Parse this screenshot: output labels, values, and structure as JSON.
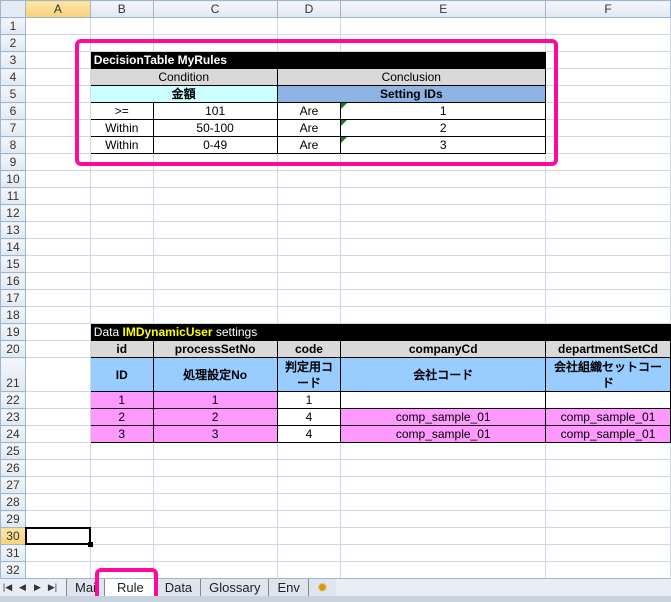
{
  "columns": [
    "A",
    "B",
    "C",
    "D",
    "E",
    "F"
  ],
  "selected_cell": {
    "column": "A",
    "row": "30"
  },
  "decision_table": {
    "title": "DecisionTable MyRules",
    "condition": "Condition",
    "conclusion": "Conclusion",
    "condition_field": "金額",
    "conclusion_field": "Setting IDs",
    "rows": [
      {
        "op": ">=",
        "value": "101",
        "cop": "Are",
        "result": "1"
      },
      {
        "op": "Within",
        "value": "50-100",
        "cop": "Are",
        "result": "2"
      },
      {
        "op": "Within",
        "value": "0-49",
        "cop": "Are",
        "result": "3"
      }
    ]
  },
  "data_table": {
    "title_prefix": "Data",
    "title_name": "IMDynamicUser",
    "title_suffix": "settings",
    "headers": [
      "id",
      "processSetNo",
      "code",
      "companyCd",
      "departmentSetCd"
    ],
    "labels": [
      "ID",
      "処理設定No",
      "判定用コード",
      "会社コード",
      "会社組織セットコード"
    ],
    "rows": [
      [
        "1",
        "1",
        "1",
        "",
        ""
      ],
      [
        "2",
        "2",
        "4",
        "comp_sample_01",
        "comp_sample_01"
      ],
      [
        "3",
        "3",
        "4",
        "comp_sample_01",
        "comp_sample_01"
      ]
    ]
  },
  "sheet_tabs": [
    "Mai",
    "Rule",
    "Data",
    "Glossary",
    "Env"
  ],
  "active_tab": "Rule",
  "colors": {
    "highlight": "#ff0a9c",
    "pink": "#ff99ff",
    "light_blue": "#99ccff",
    "cyan": "#ccffff",
    "blue": "#8db4e2"
  }
}
